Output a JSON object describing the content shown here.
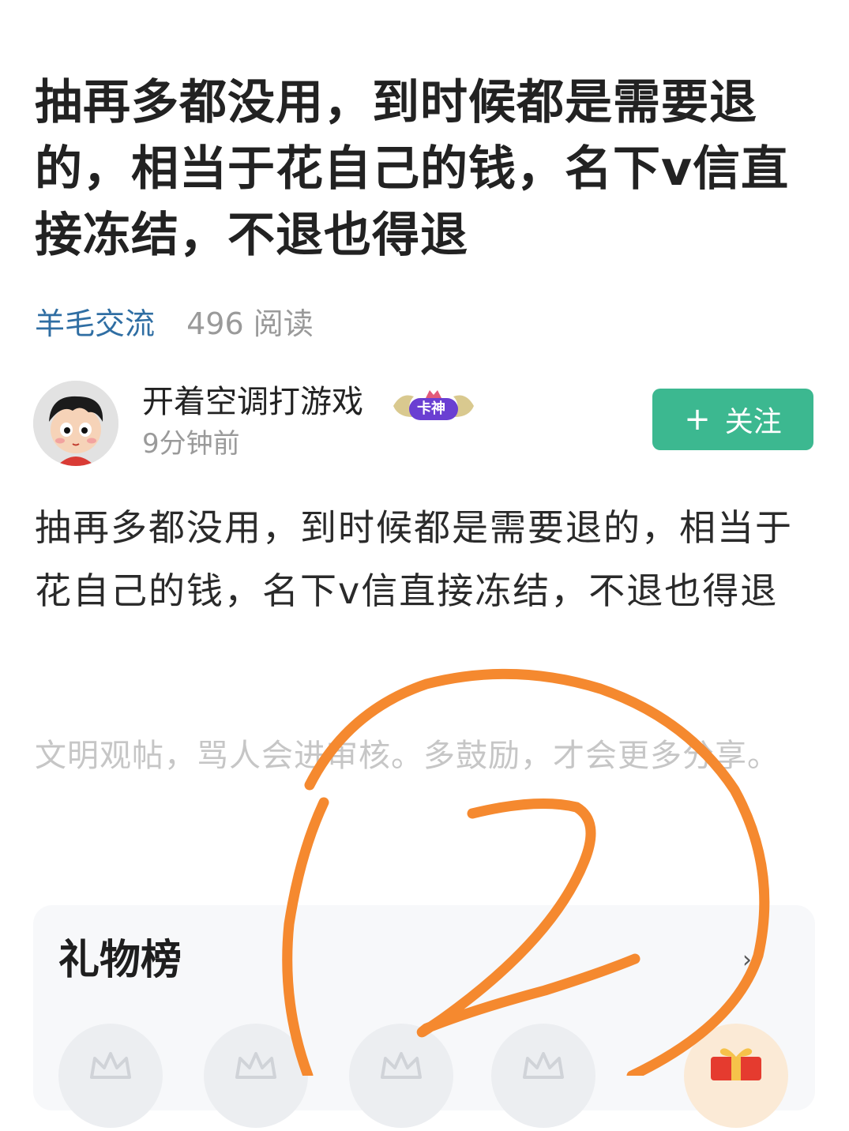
{
  "post": {
    "title": "抽再多都没用，到时候都是需要退的，相当于花自己的钱，名下v信直接冻结，不退也得退",
    "topic": "羊毛交流",
    "reads": "496 阅读",
    "body": "抽再多都没用，到时候都是需要退的，相当于花自己的钱，名下v信直接冻结，不退也得退",
    "notice": "文明观帖，骂人会进审核。多鼓励，才会更多分享。"
  },
  "author": {
    "name": "开着空调打游戏",
    "badge": "卡神",
    "time": "9分钟前",
    "follow_label": "关注",
    "follow_icon": "plus-icon"
  },
  "gift_board": {
    "title": "礼物榜",
    "slot_icon": "crown-icon",
    "gift_icon": "gift-box-icon"
  },
  "annotation": {
    "text": "2",
    "color": "#f5892f"
  }
}
